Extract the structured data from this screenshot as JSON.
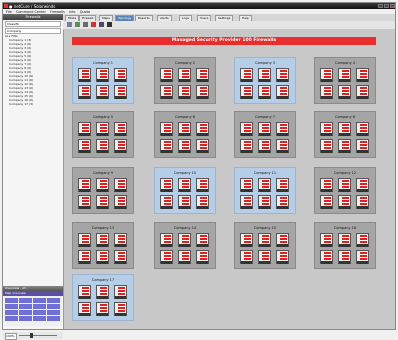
{
  "window": {
    "title": "● netCure / Solarwinds"
  },
  "menu": [
    "File",
    "Command Center",
    "Firewalls",
    "Info",
    "Quota"
  ],
  "sidebar": {
    "header": "Firewalls",
    "field1": "Classific",
    "field2": "Company",
    "tree_root": "ALL FWs",
    "tree_items": [
      "Company 1 (3)",
      "Company 2 (6)",
      "Company 3 (6)",
      "Company 4 (6)",
      "Company 5 (6)",
      "Company 6 (6)",
      "Company 7 (6)",
      "Company 8 (6)",
      "Company 9 (6)",
      "Company 10 (6)",
      "Company 11 (6)",
      "Company 12 (6)",
      "Company 13 (6)",
      "Company 14 (6)",
      "Company 15 (6)",
      "Company 16 (6)",
      "Company 17 (3)"
    ],
    "overview_bar": "Overview · All ·",
    "overview_title": "Map overview",
    "zoom": "100%"
  },
  "toolbar_tabs": [
    "Mode",
    "Firewall",
    "Maps",
    "Topology",
    "Reports",
    "Alerts",
    "Logs",
    "Users",
    "Settings",
    "Help"
  ],
  "canvas": {
    "banner": "Managed Security Provider 100 Firewalls"
  },
  "companies": [
    {
      "label": "Company 1",
      "style": "blue",
      "firewalls": 6
    },
    {
      "label": "Company 2",
      "style": "gray",
      "firewalls": 6
    },
    {
      "label": "Company 3",
      "style": "blue",
      "firewalls": 6
    },
    {
      "label": "Company 4",
      "style": "gray",
      "firewalls": 6
    },
    {
      "label": "Company 5",
      "style": "gray",
      "firewalls": 6
    },
    {
      "label": "Company 6",
      "style": "gray",
      "firewalls": 6
    },
    {
      "label": "Company 7",
      "style": "gray",
      "firewalls": 6
    },
    {
      "label": "Company 8",
      "style": "gray",
      "firewalls": 6
    },
    {
      "label": "Company 9",
      "style": "gray",
      "firewalls": 6
    },
    {
      "label": "Company 10",
      "style": "blue",
      "firewalls": 6
    },
    {
      "label": "Company 11",
      "style": "blue",
      "firewalls": 6
    },
    {
      "label": "Company 12",
      "style": "gray",
      "firewalls": 6
    },
    {
      "label": "Company 13",
      "style": "gray",
      "firewalls": 6
    },
    {
      "label": "Company 14",
      "style": "gray",
      "firewalls": 6
    },
    {
      "label": "Company 15",
      "style": "gray",
      "firewalls": 6
    },
    {
      "label": "Company 16",
      "style": "gray",
      "firewalls": 6
    },
    {
      "label": "Company 17",
      "style": "blue",
      "firewalls": 6
    }
  ],
  "colors": {
    "banner": "#e62e2e",
    "firewall_icon": "#dd2222",
    "group_blue": "#b5cde6",
    "group_gray": "#a5a5a5"
  }
}
